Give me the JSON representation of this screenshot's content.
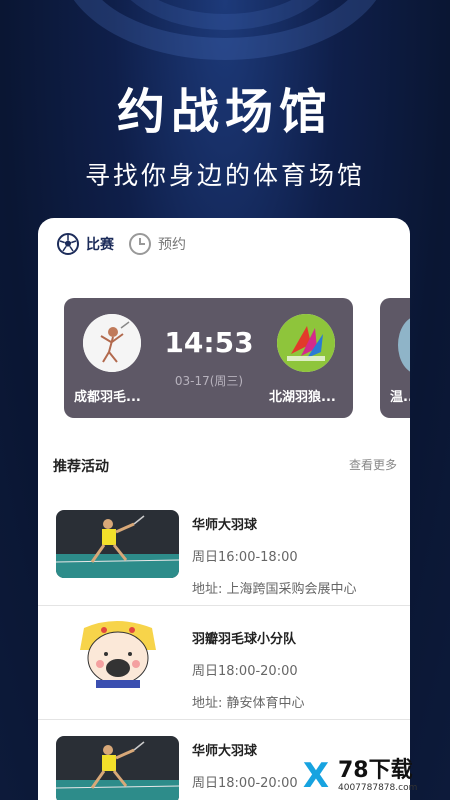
{
  "hero": {
    "title": "约战场馆",
    "subtitle": "寻找你身边的体育场馆"
  },
  "tabs": [
    {
      "label": "比赛",
      "active": true,
      "icon": "soccer-ball-icon"
    },
    {
      "label": "预约",
      "active": false,
      "icon": "clock-icon"
    }
  ],
  "match": {
    "home_team": "成都羽毛...",
    "away_team": "北湖羽狼...",
    "time": "14:53",
    "date": "03-17(周三)",
    "next_team": "温..."
  },
  "section": {
    "title": "推荐活动",
    "more": "查看更多"
  },
  "activities": [
    {
      "title": "华师大羽球",
      "time": "周日16:00-18:00",
      "address": "地址: 上海跨国采购会展中心"
    },
    {
      "title": "羽瓣羽毛球小分队",
      "time": "周日18:00-20:00",
      "address": "地址: 静安体育中心"
    },
    {
      "title": "华师大羽球",
      "time": "周日18:00-20:00",
      "address": ""
    }
  ],
  "watermark": {
    "logo": "X",
    "name": "78下载",
    "url": "4007787878.com"
  },
  "colors": {
    "background": "#0f1f4a",
    "match_card": "#5e5866",
    "accent": "#1c2c5a"
  }
}
